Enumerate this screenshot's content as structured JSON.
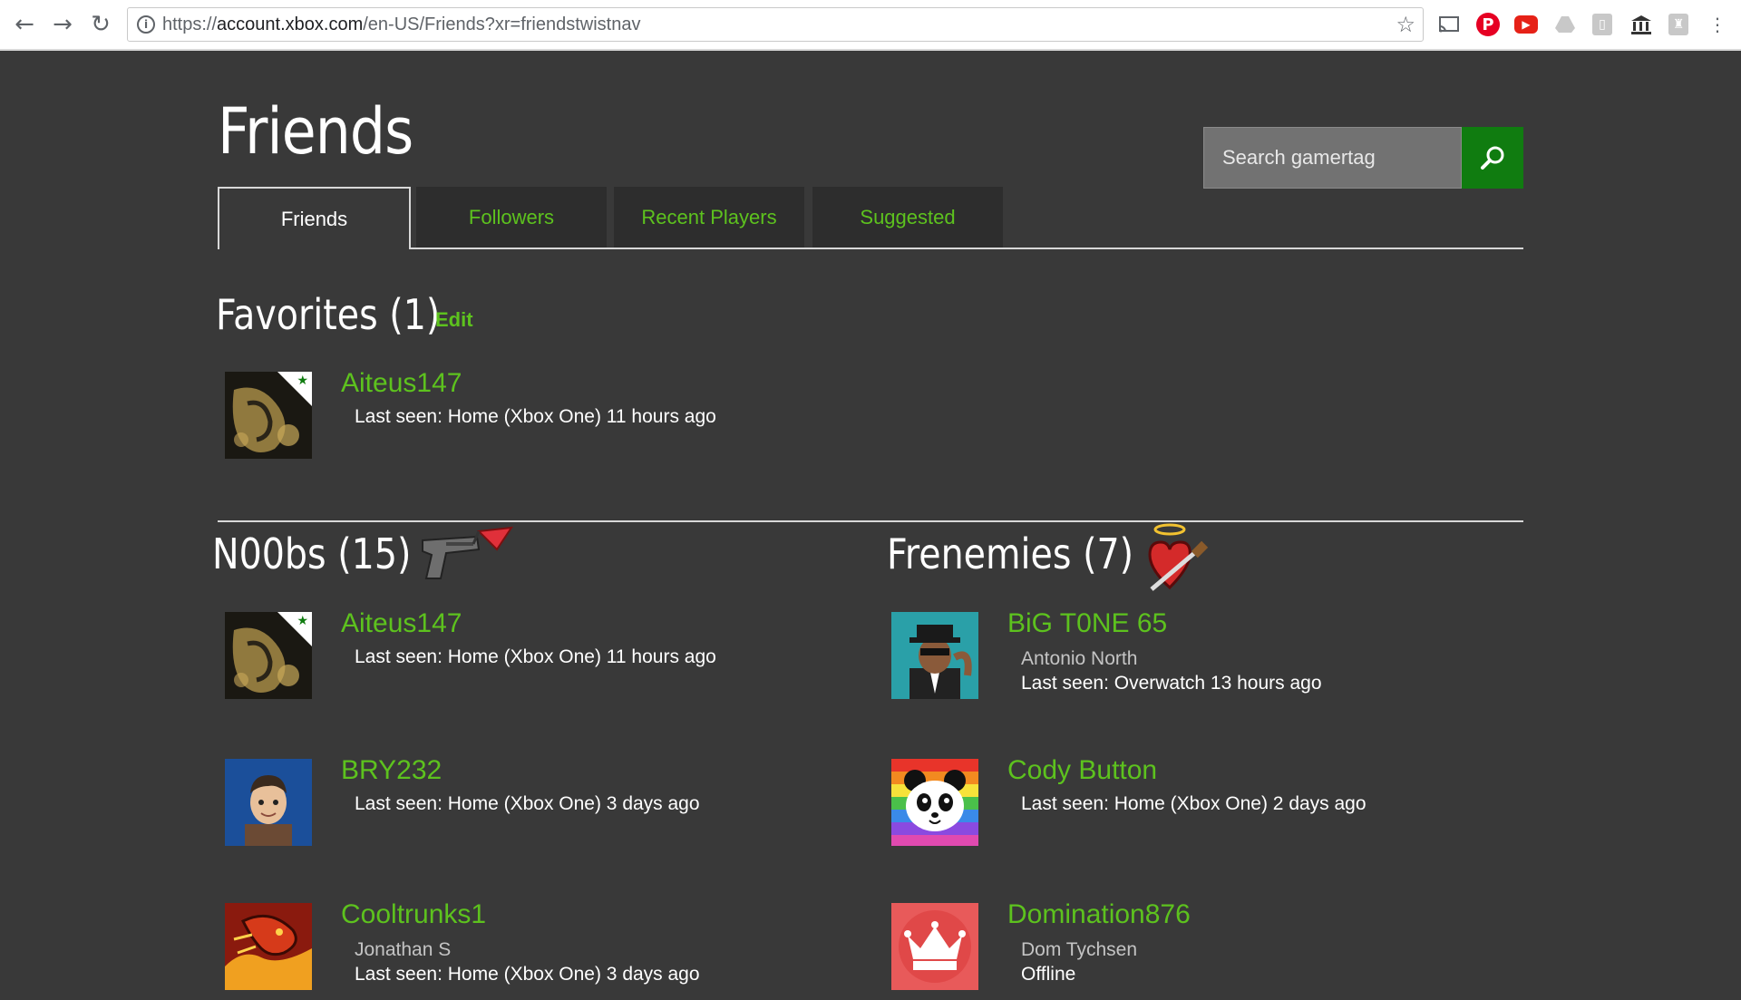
{
  "browser": {
    "url_prefix": "https://",
    "url_host": "account.xbox.com",
    "url_path": "/en-US/Friends?xr=friendstwistnav"
  },
  "page": {
    "title": "Friends",
    "search_placeholder": "Search gamertag"
  },
  "tabs": [
    {
      "label": "Friends",
      "active": true
    },
    {
      "label": "Followers",
      "active": false
    },
    {
      "label": "Recent Players",
      "active": false
    },
    {
      "label": "Suggested",
      "active": false
    }
  ],
  "favorites": {
    "heading": "Favorites (1)",
    "edit_label": "Edit",
    "items": [
      {
        "gamertag": "Aiteus147",
        "last_seen": "Last seen: Home (Xbox One) 11 hours ago"
      }
    ]
  },
  "groups": [
    {
      "heading": "N00bs (15)",
      "icon": "gun-icon",
      "items": [
        {
          "gamertag": "Aiteus147",
          "last_seen": "Last seen: Home (Xbox One) 11 hours ago"
        },
        {
          "gamertag": "BRY232",
          "last_seen": "Last seen: Home (Xbox One) 3 days ago"
        },
        {
          "gamertag": "Cooltrunks1",
          "real_name": "Jonathan S",
          "last_seen": "Last seen: Home (Xbox One) 3 days ago"
        }
      ]
    },
    {
      "heading": "Frenemies (7)",
      "icon": "stabbed-heart-icon",
      "items": [
        {
          "gamertag": "BiG T0NE 65",
          "real_name": "Antonio North",
          "last_seen": "Last seen: Overwatch 13 hours ago"
        },
        {
          "gamertag": "Cody Button",
          "last_seen": "Last seen: Home (Xbox One) 2 days ago"
        },
        {
          "gamertag": "Domination876",
          "real_name": "Dom Tychsen",
          "last_seen": "Offline"
        }
      ]
    }
  ],
  "colors": {
    "accent_green": "#5dc21e",
    "button_green": "#107c10",
    "background": "#393939"
  }
}
